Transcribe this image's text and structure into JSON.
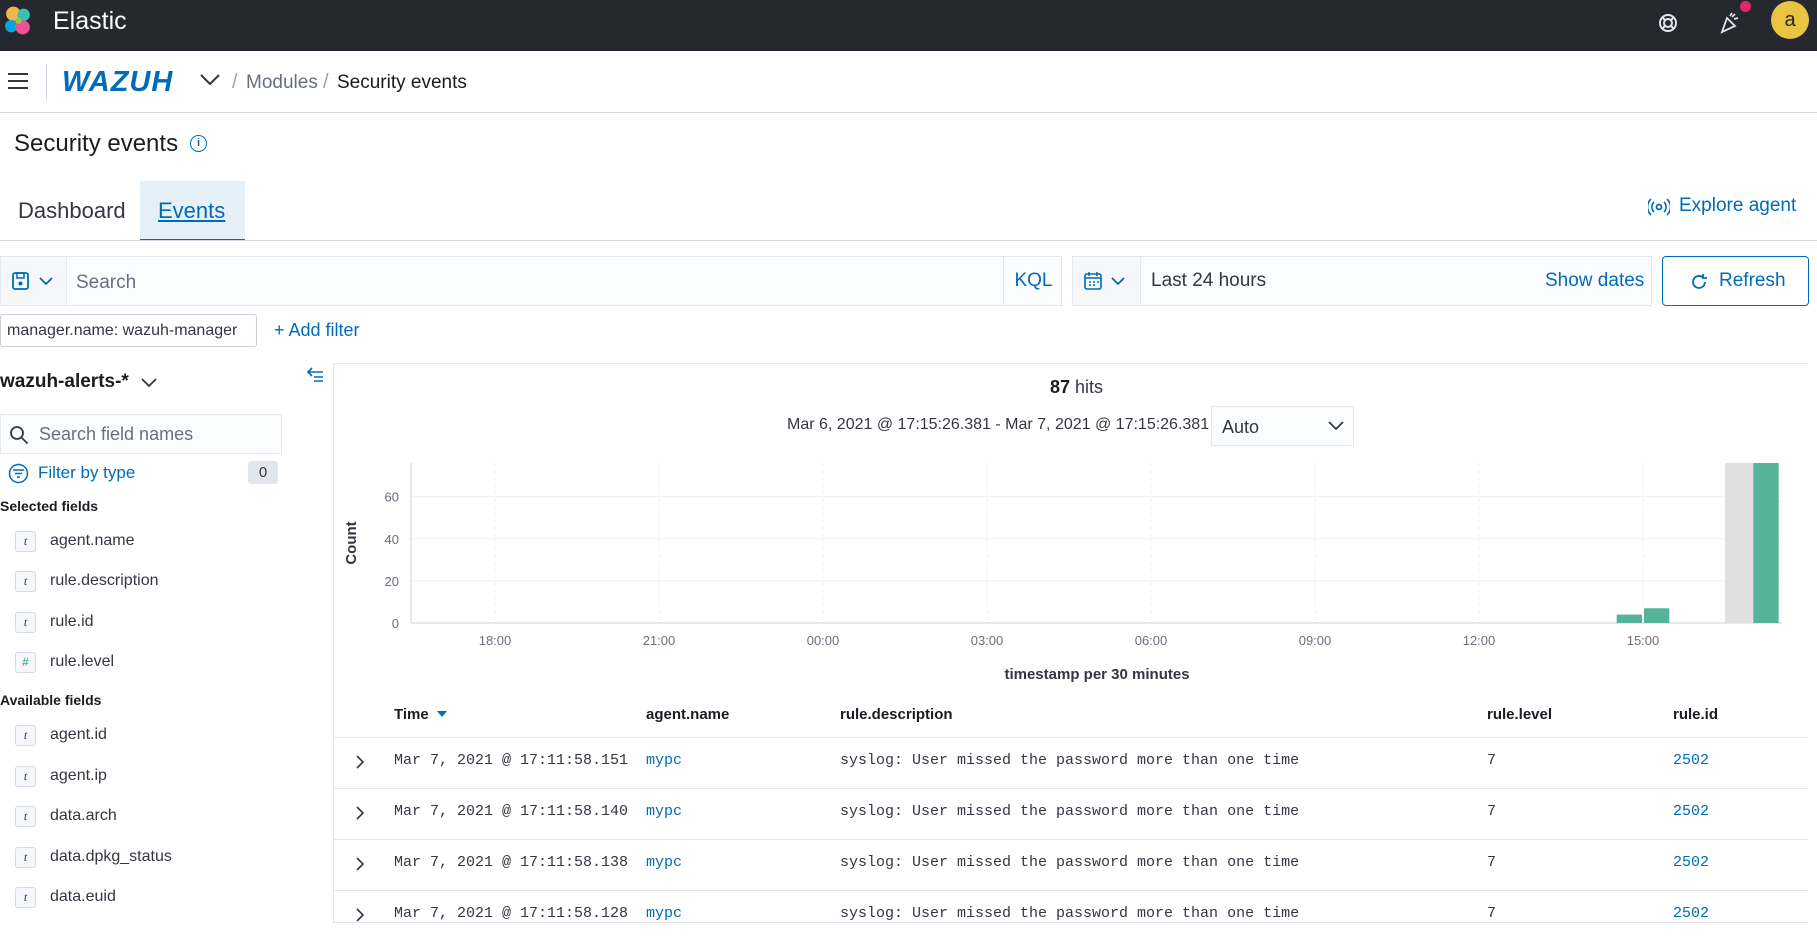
{
  "app": {
    "title": "Elastic",
    "avatar_initial": "a"
  },
  "breadcrumb": {
    "logo": "WAZUH",
    "items": [
      "Modules",
      "Security events"
    ]
  },
  "page": {
    "title": "Security events"
  },
  "tabs": [
    {
      "label": "Dashboard",
      "active": false
    },
    {
      "label": "Events",
      "active": true
    }
  ],
  "explore_agent": "Explore agent",
  "search": {
    "placeholder": "Search",
    "language": "KQL"
  },
  "date_picker": {
    "value": "Last 24 hours",
    "show_dates": "Show dates"
  },
  "refresh_label": "Refresh",
  "filters": {
    "pill": "manager.name: wazuh-manager",
    "add": "+ Add filter"
  },
  "sidebar": {
    "index_pattern": "wazuh-alerts-*",
    "field_search_placeholder": "Search field names",
    "filter_by_type": "Filter by type",
    "filter_count": "0",
    "selected_title": "Selected fields",
    "selected": [
      {
        "type": "t",
        "name": "agent.name"
      },
      {
        "type": "t",
        "name": "rule.description"
      },
      {
        "type": "t",
        "name": "rule.id"
      },
      {
        "type": "#",
        "name": "rule.level"
      }
    ],
    "available_title": "Available fields",
    "available": [
      {
        "type": "t",
        "name": "agent.id"
      },
      {
        "type": "t",
        "name": "agent.ip"
      },
      {
        "type": "t",
        "name": "data.arch"
      },
      {
        "type": "t",
        "name": "data.dpkg_status"
      },
      {
        "type": "t",
        "name": "data.euid"
      }
    ]
  },
  "histogram": {
    "hits_count": "87",
    "hits_label": "hits",
    "range": "Mar 6, 2021 @ 17:15:26.381 - Mar 7, 2021 @ 17:15:26.381",
    "interval": "Auto"
  },
  "chart_data": {
    "type": "bar",
    "ylabel": "Count",
    "xlabel": "timestamp per 30 minutes",
    "x_ticks": [
      "18:00",
      "21:00",
      "00:00",
      "03:00",
      "06:00",
      "09:00",
      "12:00",
      "15:00"
    ],
    "y_ticks": [
      0,
      20,
      40,
      60
    ],
    "ylim": [
      0,
      76
    ],
    "bar_color": "#54b399",
    "bars": [
      {
        "time": "14:30",
        "value": 4
      },
      {
        "time": "15:00",
        "value": 7
      },
      {
        "time": "17:00",
        "value": 76
      }
    ],
    "highlight_bucket": "16:30"
  },
  "table": {
    "columns": [
      "Time",
      "agent.name",
      "rule.description",
      "rule.level",
      "rule.id"
    ],
    "rows": [
      [
        "Mar 7, 2021 @ 17:11:58.151",
        "mypc",
        "syslog: User missed the password more than one time",
        "7",
        "2502"
      ],
      [
        "Mar 7, 2021 @ 17:11:58.140",
        "mypc",
        "syslog: User missed the password more than one time",
        "7",
        "2502"
      ],
      [
        "Mar 7, 2021 @ 17:11:58.138",
        "mypc",
        "syslog: User missed the password more than one time",
        "7",
        "2502"
      ],
      [
        "Mar 7, 2021 @ 17:11:58.128",
        "mypc",
        "syslog: User missed the password more than one time",
        "7",
        "2502"
      ]
    ]
  }
}
